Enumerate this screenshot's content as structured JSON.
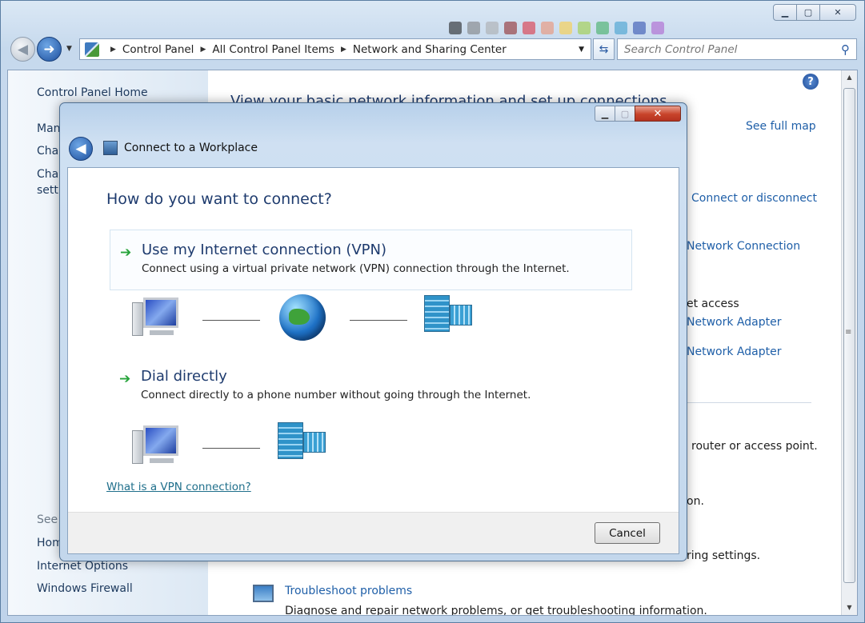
{
  "colors": {
    "link": "#1f5fa8",
    "heading": "#1e3b6e",
    "accent_arrow": "#26a33a"
  },
  "explorer": {
    "breadcrumb": [
      "Control Panel",
      "All Control Panel Items",
      "Network and Sharing Center"
    ],
    "search_placeholder": "Search Control Panel",
    "sidebar": {
      "home": "Control Panel Home",
      "item1": "Man",
      "item2": "Char",
      "item3a": "Char",
      "item3b": "setti",
      "see_also": "See a",
      "home_group": "Hom",
      "internet_options": "Internet Options",
      "windows_firewall": "Windows Firewall"
    },
    "main": {
      "heading": "View your basic network information and set up connections",
      "see_full_map": "See full map",
      "connect_disconnect": "Connect or disconnect",
      "network_connection": "Network Connection",
      "internet_access": "et access",
      "network_adapter_1": "Network Adapter",
      "network_adapter_2": "Network Adapter",
      "router_text": "router or access point.",
      "on_text": "on.",
      "sharing_settings": "ring settings.",
      "troubleshoot_title": "Troubleshoot problems",
      "troubleshoot_desc": "Diagnose and repair network problems, or get troubleshooting information."
    }
  },
  "dialog": {
    "title": "Connect to a Workplace",
    "question": "How do you want to connect?",
    "options": [
      {
        "title": "Use my Internet connection (VPN)",
        "description": "Connect using a virtual private network (VPN) connection through the Internet."
      },
      {
        "title": "Dial directly",
        "description": "Connect directly to a phone number without going through the Internet."
      }
    ],
    "vpn_link": "What is a VPN connection?",
    "cancel_label": "Cancel",
    "close_glyph": "✕"
  }
}
